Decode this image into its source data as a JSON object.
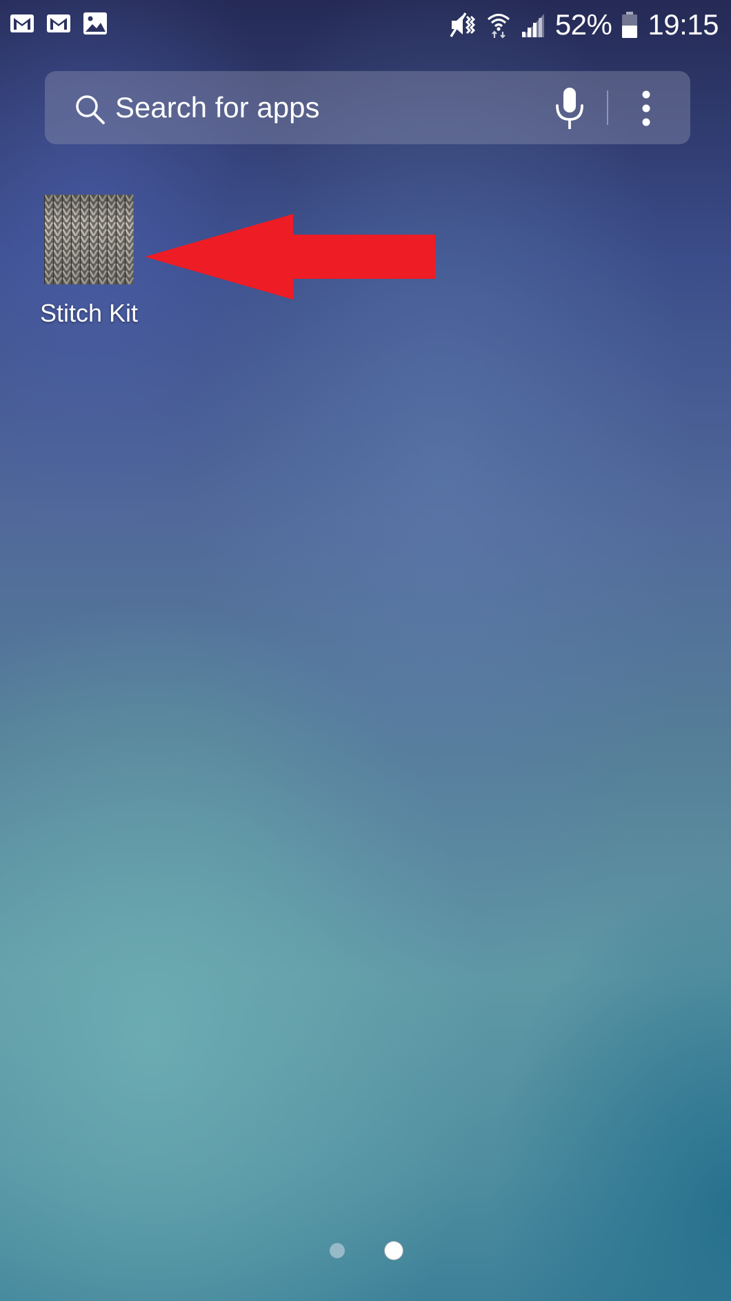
{
  "status_bar": {
    "notification_icons": [
      "gmail-icon",
      "gmail-icon",
      "gallery-icon"
    ],
    "system_icons": [
      "mute-vibrate-icon",
      "wifi-icon",
      "signal-icon",
      "battery-icon"
    ],
    "battery_percent": "52%",
    "time": "19:15"
  },
  "search": {
    "placeholder": "Search for apps",
    "icons": [
      "search-icon",
      "mic-icon",
      "more-vert-icon"
    ]
  },
  "apps": [
    {
      "label": "Stitch Kit",
      "icon": "knitting-texture-icon"
    }
  ],
  "annotation": {
    "type": "arrow",
    "direction": "left",
    "color": "#ee1c24"
  },
  "page_indicator": {
    "total_pages": 2,
    "current_page": 2
  }
}
